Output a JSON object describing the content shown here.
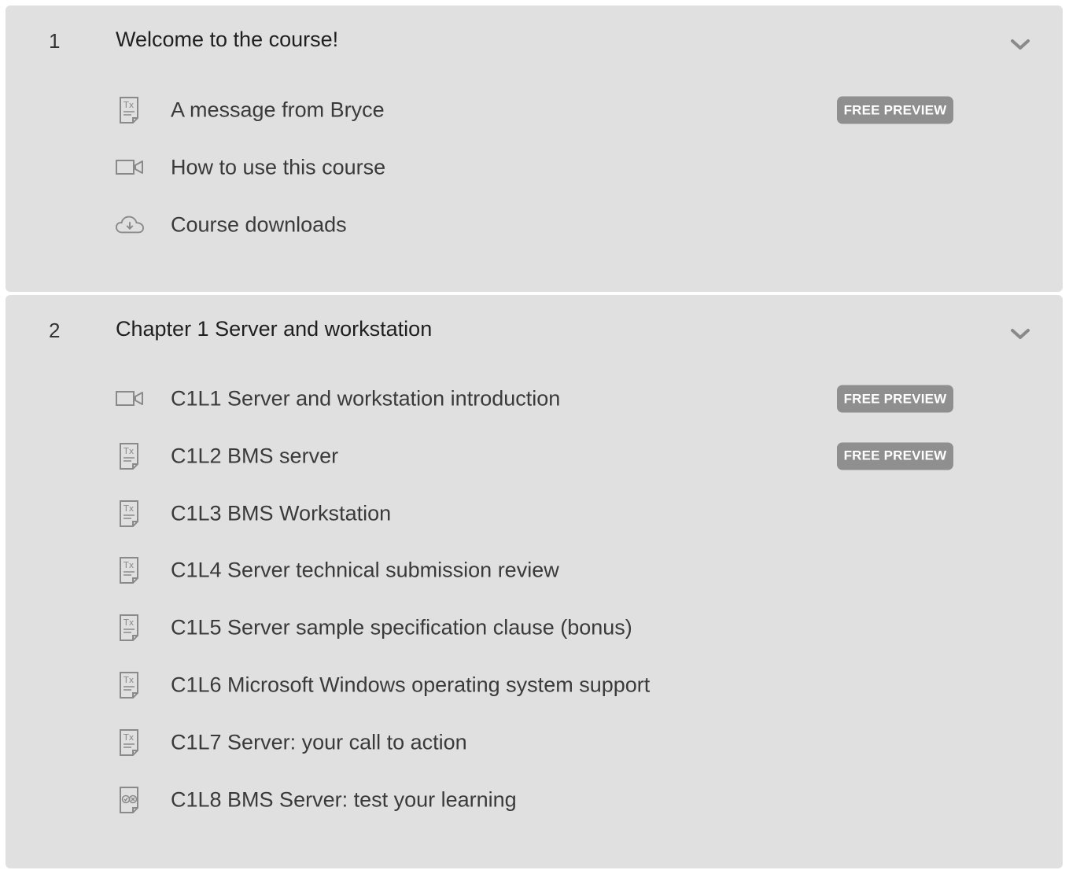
{
  "chapters": [
    {
      "number": "1",
      "title": "Welcome to the course!",
      "lessons": [
        {
          "icon": "text-document-icon",
          "title": "A message from Bryce",
          "badge": "FREE PREVIEW"
        },
        {
          "icon": "video-icon",
          "title": "How to use this course",
          "badge": ""
        },
        {
          "icon": "cloud-download-icon",
          "title": "Course downloads",
          "badge": ""
        }
      ]
    },
    {
      "number": "2",
      "title": "Chapter 1 Server and workstation",
      "lessons": [
        {
          "icon": "video-icon",
          "title": "C1L1 Server and workstation introduction",
          "badge": "FREE PREVIEW"
        },
        {
          "icon": "text-document-icon",
          "title": "C1L2 BMS server",
          "badge": "FREE PREVIEW"
        },
        {
          "icon": "text-document-icon",
          "title": "C1L3 BMS Workstation",
          "badge": ""
        },
        {
          "icon": "text-document-icon",
          "title": "C1L4 Server technical submission review",
          "badge": ""
        },
        {
          "icon": "text-document-icon",
          "title": "C1L5 Server sample specification clause (bonus)",
          "badge": ""
        },
        {
          "icon": "text-document-icon",
          "title": "C1L6 Microsoft Windows operating system support",
          "badge": ""
        },
        {
          "icon": "text-document-icon",
          "title": "C1L7 Server: your call to action",
          "badge": ""
        },
        {
          "icon": "quiz-icon",
          "title": "C1L8 BMS Server: test your learning",
          "badge": ""
        }
      ]
    }
  ],
  "colors": {
    "panel_bg": "#e0e0e0",
    "badge_bg": "#8f8f8f",
    "icon": "#8a8a8a",
    "text": "#3a3a3a"
  }
}
